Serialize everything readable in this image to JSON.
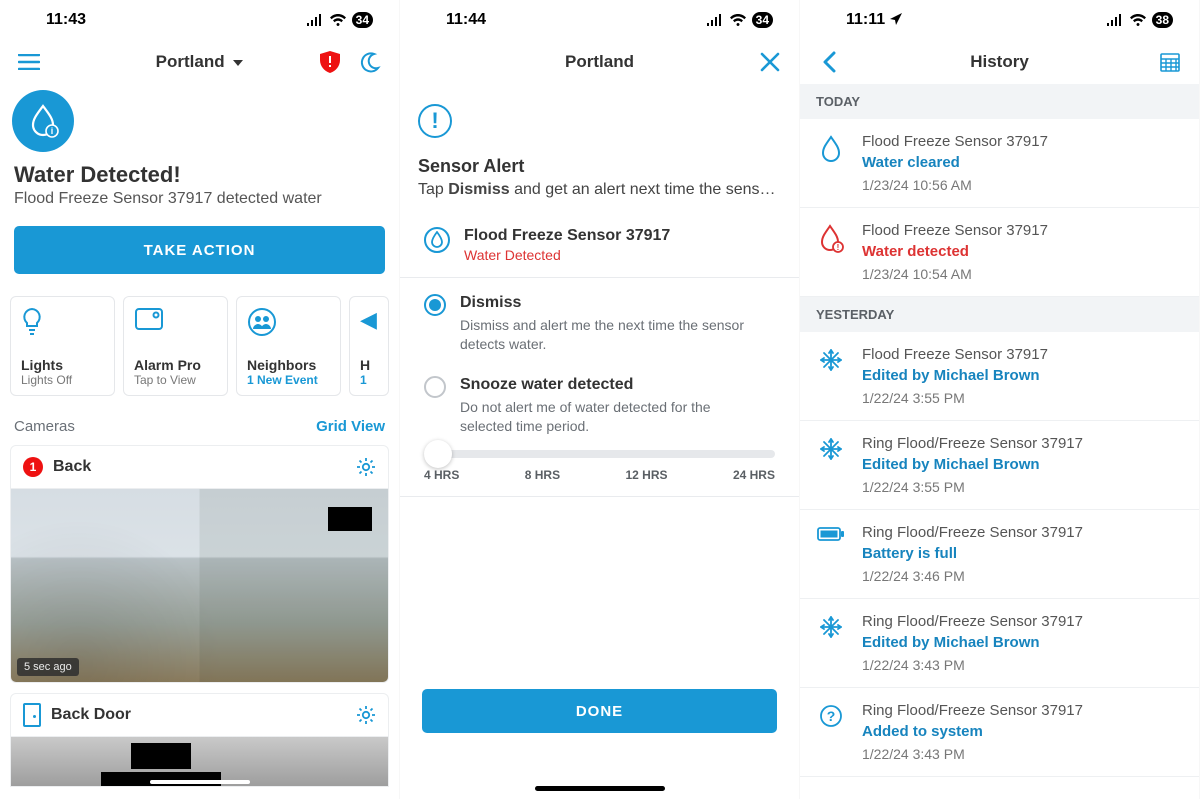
{
  "panel1": {
    "status_time": "11:43",
    "battery": "34",
    "location": "Portland",
    "alert_title": "Water Detected!",
    "alert_sub": "Flood Freeze Sensor 37917 detected water",
    "take_action": "TAKE ACTION",
    "tiles": [
      {
        "label": "Lights",
        "sub": "Lights Off",
        "sub_blue": false
      },
      {
        "label": "Alarm Pro",
        "sub": "Tap to View",
        "sub_blue": false
      },
      {
        "label": "Neighbors",
        "sub": "1 New Event",
        "sub_blue": true
      },
      {
        "label": "H",
        "sub": "1",
        "sub_blue": true
      }
    ],
    "cameras_label": "Cameras",
    "grid_view": "Grid View",
    "cam1_badge": "1",
    "cam1_name": "Back",
    "cam1_ts": "5 sec ago",
    "cam2_name": "Back Door"
  },
  "panel2": {
    "status_time": "11:44",
    "battery": "34",
    "location": "Portland",
    "heading": "Sensor Alert",
    "subline_pre": "Tap ",
    "subline_bold": "Dismiss",
    "subline_post": " and get an alert next time the sens…",
    "device_name": "Flood Freeze Sensor 37917",
    "device_status": "Water Detected",
    "opt_dismiss_title": "Dismiss",
    "opt_dismiss_desc": "Dismiss and alert me the next time the sensor detects water.",
    "opt_snooze_title": "Snooze water detected",
    "opt_snooze_desc": "Do not alert me of water detected for the selected time period.",
    "ticks": [
      "4 HRS",
      "8 HRS",
      "12 HRS",
      "24 HRS"
    ],
    "done": "DONE"
  },
  "panel3": {
    "status_time": "11:11",
    "battery": "38",
    "title": "History",
    "section_today": "TODAY",
    "section_yesterday": "YESTERDAY",
    "events": [
      {
        "device": "Flood Freeze Sensor 37917",
        "type": "Water cleared",
        "type_class": "blue",
        "time": "1/23/24  10:56 AM",
        "icon": "drop-blue"
      },
      {
        "device": "Flood Freeze Sensor 37917",
        "type": "Water detected",
        "type_class": "red",
        "time": "1/23/24  10:54 AM",
        "icon": "drop-red"
      },
      {
        "device": "Flood Freeze Sensor 37917",
        "type": "Edited by Michael Brown",
        "type_class": "blue",
        "time": "1/22/24  3:55 PM",
        "icon": "freeze"
      },
      {
        "device": "Ring Flood/Freeze Sensor 37917",
        "type": "Edited by Michael Brown",
        "type_class": "blue",
        "time": "1/22/24  3:55 PM",
        "icon": "freeze"
      },
      {
        "device": "Ring Flood/Freeze Sensor 37917",
        "type": "Battery is full",
        "type_class": "blue",
        "time": "1/22/24  3:46 PM",
        "icon": "battery"
      },
      {
        "device": "Ring Flood/Freeze Sensor 37917",
        "type": "Edited by Michael Brown",
        "type_class": "blue",
        "time": "1/22/24  3:43 PM",
        "icon": "freeze"
      },
      {
        "device": "Ring Flood/Freeze Sensor 37917",
        "type": "Added to system",
        "type_class": "blue",
        "time": "1/22/24  3:43 PM",
        "icon": "question"
      }
    ]
  }
}
